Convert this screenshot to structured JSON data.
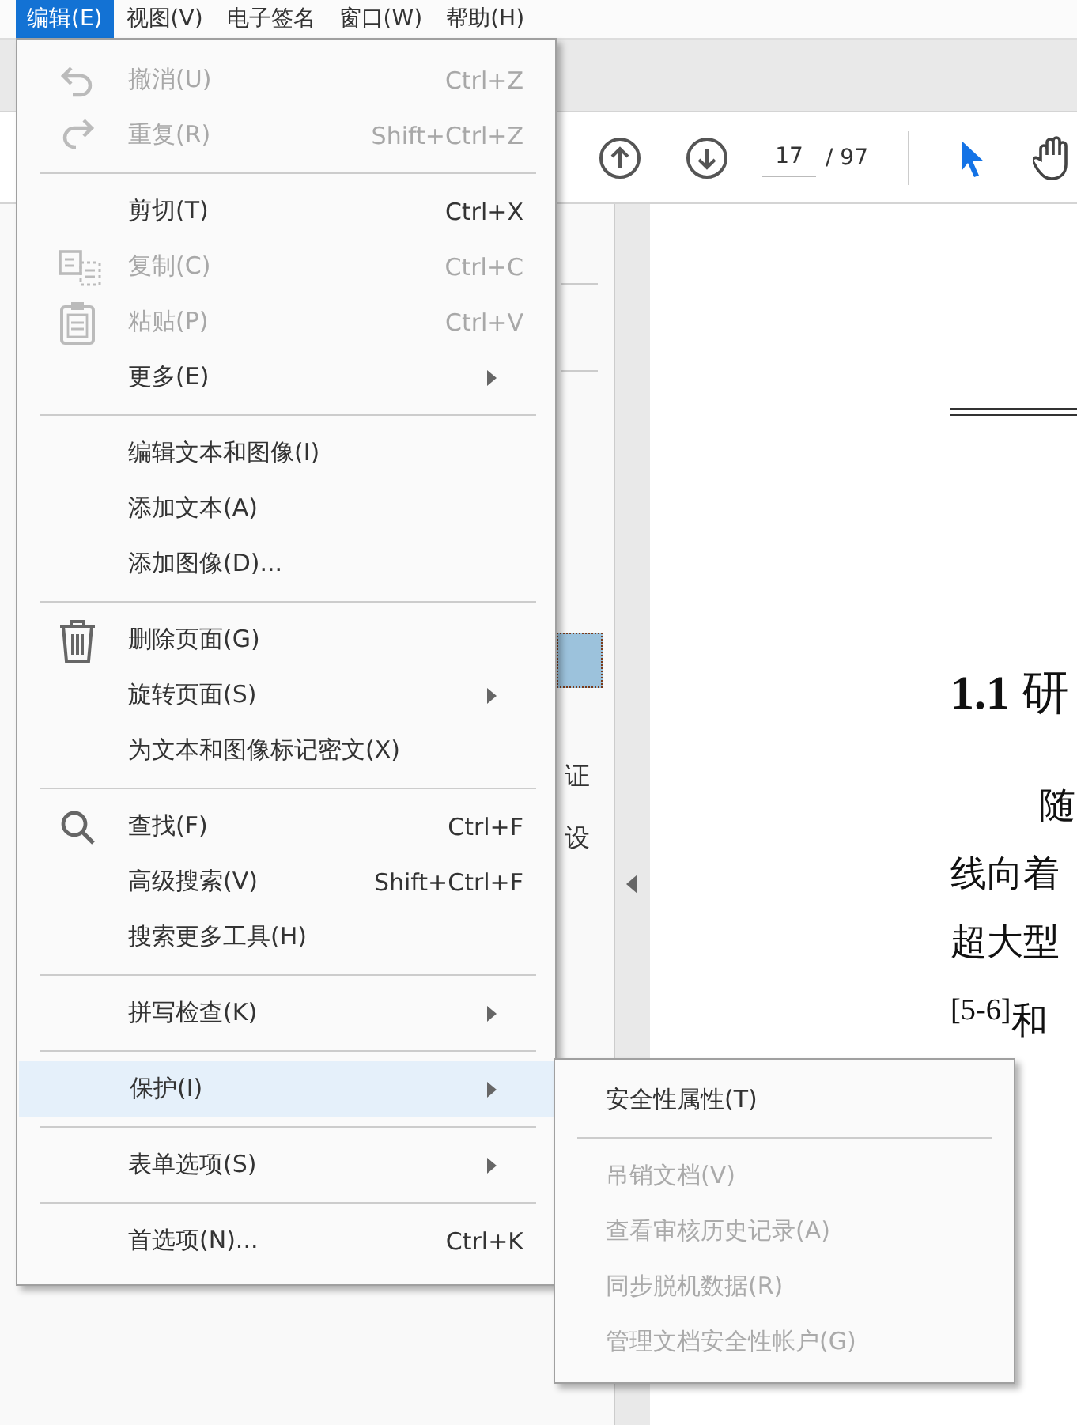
{
  "menubar": [
    {
      "label": "编辑(E)",
      "selected": true
    },
    {
      "label": "视图(V)",
      "selected": false
    },
    {
      "label": "电子签名",
      "selected": false
    },
    {
      "label": "窗口(W)",
      "selected": false
    },
    {
      "label": "帮助(H)",
      "selected": false
    }
  ],
  "toolbar": {
    "page": "17",
    "total": "/ 97"
  },
  "sidebar": {
    "fragments": [
      "证",
      "设"
    ]
  },
  "document": {
    "heading_number": "1.1",
    "heading_text": "研",
    "lines": [
      "随",
      "线向着",
      "超大型",
      "$^{[5-6]}$和"
    ]
  },
  "edit_menu": {
    "items": [
      {
        "kind": "item",
        "label": "撤消(U)",
        "shortcut": "Ctrl+Z",
        "disabled": true,
        "submenu": false,
        "selected": false
      },
      {
        "kind": "item",
        "label": "重复(R)",
        "shortcut": "Shift+Ctrl+Z",
        "disabled": true,
        "submenu": false,
        "selected": false
      },
      {
        "kind": "separator"
      },
      {
        "kind": "item",
        "label": "剪切(T)",
        "shortcut": "Ctrl+X",
        "disabled": false,
        "submenu": false,
        "selected": false
      },
      {
        "kind": "item",
        "label": "复制(C)",
        "shortcut": "Ctrl+C",
        "disabled": true,
        "submenu": false,
        "selected": false
      },
      {
        "kind": "item",
        "label": "粘贴(P)",
        "shortcut": "Ctrl+V",
        "disabled": true,
        "submenu": false,
        "selected": false
      },
      {
        "kind": "item",
        "label": "更多(E)",
        "disabled": false,
        "submenu": true,
        "selected": false
      },
      {
        "kind": "separator"
      },
      {
        "kind": "item",
        "label": "编辑文本和图像(I)",
        "disabled": false,
        "submenu": false,
        "selected": false
      },
      {
        "kind": "item",
        "label": "添加文本(A)",
        "disabled": false,
        "submenu": false,
        "selected": false
      },
      {
        "kind": "item",
        "label": "添加图像(D)...",
        "disabled": false,
        "submenu": false,
        "selected": false
      },
      {
        "kind": "separator"
      },
      {
        "kind": "item",
        "label": "删除页面(G)",
        "disabled": false,
        "submenu": false,
        "selected": false
      },
      {
        "kind": "item",
        "label": "旋转页面(S)",
        "disabled": false,
        "submenu": true,
        "selected": false
      },
      {
        "kind": "item",
        "label": "为文本和图像标记密文(X)",
        "disabled": false,
        "submenu": false,
        "selected": false
      },
      {
        "kind": "separator"
      },
      {
        "kind": "item",
        "label": "查找(F)",
        "shortcut": "Ctrl+F",
        "disabled": false,
        "submenu": false,
        "selected": false
      },
      {
        "kind": "item",
        "label": "高级搜索(V)",
        "shortcut": "Shift+Ctrl+F",
        "disabled": false,
        "submenu": false,
        "selected": false
      },
      {
        "kind": "item",
        "label": "搜索更多工具(H)",
        "disabled": false,
        "submenu": false,
        "selected": false
      },
      {
        "kind": "separator"
      },
      {
        "kind": "item",
        "label": "拼写检查(K)",
        "disabled": false,
        "submenu": true,
        "selected": false
      },
      {
        "kind": "separator"
      },
      {
        "kind": "item",
        "label": "保护(I)",
        "disabled": false,
        "submenu": true,
        "selected": true
      },
      {
        "kind": "separator"
      },
      {
        "kind": "item",
        "label": "表单选项(S)",
        "disabled": false,
        "submenu": true,
        "selected": false
      },
      {
        "kind": "separator"
      },
      {
        "kind": "item",
        "label": "首选项(N)...",
        "shortcut": "Ctrl+K",
        "disabled": false,
        "submenu": false,
        "selected": false
      }
    ]
  },
  "protect_submenu": {
    "items": [
      {
        "kind": "item",
        "label": "安全性属性(T)",
        "disabled": false
      },
      {
        "kind": "separator"
      },
      {
        "kind": "item",
        "label": "吊销文档(V)",
        "disabled": true
      },
      {
        "kind": "item",
        "label": "查看审核历史记录(A)",
        "disabled": true
      },
      {
        "kind": "item",
        "label": "同步脱机数据(R)",
        "disabled": true
      },
      {
        "kind": "item",
        "label": "管理文档安全性帐户(G)",
        "disabled": true
      }
    ]
  }
}
